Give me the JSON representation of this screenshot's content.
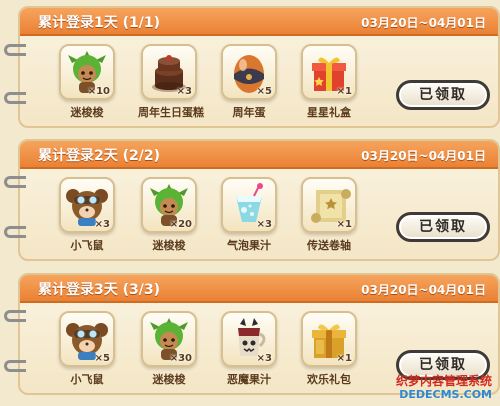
{
  "colors": {
    "header": "#ea8134",
    "panel": "#f4e6c6",
    "button_border": "#3f3a35"
  },
  "panels": [
    {
      "title": "累计登录1天 (1/1)",
      "date": "03月20日~04月01日",
      "button": "已领取",
      "items": [
        {
          "name": "迷梭梭",
          "count": "×10",
          "icon": "green-sprite-icon"
        },
        {
          "name": "周年生日蛋糕",
          "count": "×3",
          "icon": "chocolate-cake-icon"
        },
        {
          "name": "周年蛋",
          "count": "×5",
          "icon": "anniversary-egg-icon"
        },
        {
          "name": "星星礼盒",
          "count": "×1",
          "icon": "star-gift-box-icon"
        }
      ]
    },
    {
      "title": "累计登录2天 (2/2)",
      "date": "03月20日~04月01日",
      "button": "已领取",
      "items": [
        {
          "name": "小飞鼠",
          "count": "×3",
          "icon": "flying-mouse-pilot-icon"
        },
        {
          "name": "迷梭梭",
          "count": "×20",
          "icon": "green-sprite-icon"
        },
        {
          "name": "气泡果汁",
          "count": "×3",
          "icon": "bubble-juice-icon"
        },
        {
          "name": "传送卷轴",
          "count": "×1",
          "icon": "teleport-scroll-icon"
        }
      ]
    },
    {
      "title": "累计登录3天 (3/3)",
      "date": "03月20日~04月01日",
      "button": "已领取",
      "items": [
        {
          "name": "小飞鼠",
          "count": "×5",
          "icon": "flying-mouse-pilot-icon"
        },
        {
          "name": "迷梭梭",
          "count": "×30",
          "icon": "green-sprite-icon"
        },
        {
          "name": "恶魔果汁",
          "count": "×3",
          "icon": "devil-juice-icon"
        },
        {
          "name": "欢乐礼包",
          "count": "×1",
          "icon": "gold-gift-box-icon"
        }
      ]
    }
  ],
  "watermark": {
    "text": "织梦内容管理系统",
    "url": "DEDECMS.COM"
  }
}
